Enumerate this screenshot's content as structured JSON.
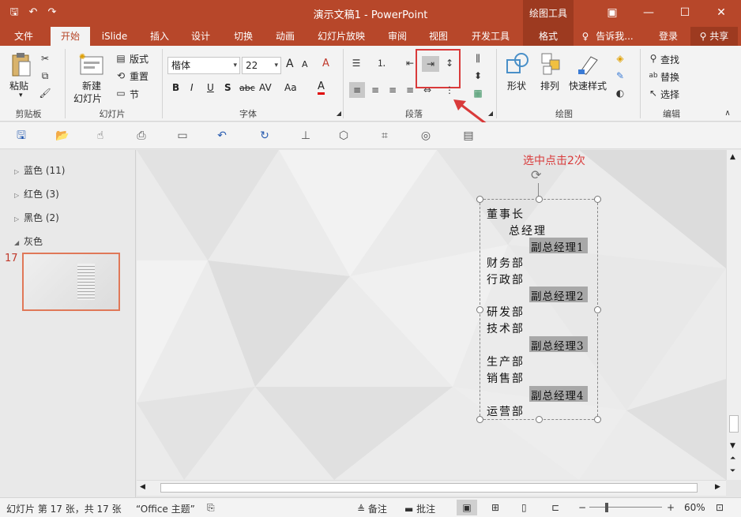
{
  "window": {
    "title": "演示文稿1 - PowerPoint",
    "context_group": "绘图工具",
    "buttons": {
      "restore_ribbon": "▣",
      "minimize": "—",
      "maximize": "☐",
      "close": "✕"
    }
  },
  "tabs": [
    {
      "label": "文件"
    },
    {
      "label": "开始"
    },
    {
      "label": "iSlide"
    },
    {
      "label": "插入"
    },
    {
      "label": "设计"
    },
    {
      "label": "切换"
    },
    {
      "label": "动画"
    },
    {
      "label": "幻灯片放映"
    },
    {
      "label": "审阅"
    },
    {
      "label": "视图"
    },
    {
      "label": "开发工具"
    },
    {
      "label": "格式"
    }
  ],
  "tell_me": "告诉我...",
  "login": "登录",
  "share": "共享",
  "ribbon": {
    "clipboard": {
      "label": "剪贴板",
      "paste": "粘贴"
    },
    "slides": {
      "label": "幻灯片",
      "new_slide_1": "新建",
      "new_slide_2": "幻灯片",
      "layout": "版式",
      "reset": "重置",
      "section": "节"
    },
    "font": {
      "label": "字体",
      "name": "楷体",
      "size": "22",
      "grow": "A",
      "shrink": "A",
      "clear": "A",
      "bold": "B",
      "italic": "I",
      "underline": "U",
      "shadow": "S",
      "strike": "abc",
      "spacing": "AV",
      "case": "Aa",
      "color": "A"
    },
    "paragraph": {
      "label": "段落"
    },
    "drawing": {
      "label": "绘图",
      "shape": "形状",
      "arrange": "排列",
      "quick_style": "快速样式"
    },
    "editing": {
      "label": "编辑",
      "find": "查找",
      "replace": "替换",
      "select": "选择"
    }
  },
  "sections": [
    {
      "label": "蓝色 (11)"
    },
    {
      "label": "红色 (3)"
    },
    {
      "label": "黑色 (2)"
    },
    {
      "label": "灰色"
    }
  ],
  "thumbnail": {
    "number": "17"
  },
  "slide": {
    "annotation": "选中点击2次",
    "lines": [
      {
        "text": "董事长",
        "highlight": false
      },
      {
        "text": "总经理",
        "highlight": false
      },
      {
        "text": "副总经理1",
        "highlight": true
      },
      {
        "text": "财务部",
        "highlight": false
      },
      {
        "text": "行政部",
        "highlight": false
      },
      {
        "text": "副总经理2",
        "highlight": true
      },
      {
        "text": "研发部",
        "highlight": false
      },
      {
        "text": "技术部",
        "highlight": false
      },
      {
        "text": "副总经理3",
        "highlight": true
      },
      {
        "text": "生产部",
        "highlight": false
      },
      {
        "text": "销售部",
        "highlight": false
      },
      {
        "text": "副总经理4",
        "highlight": true
      },
      {
        "text": "运营部",
        "highlight": false
      }
    ]
  },
  "statusbar": {
    "slide_info": "幻灯片 第 17 张，共 17 张",
    "theme": "“Office 主题”",
    "notes": "备注",
    "comments": "批注",
    "zoom": "60%"
  },
  "colors": {
    "accent": "#b7472a",
    "highlight_box": "#d93a3a"
  }
}
